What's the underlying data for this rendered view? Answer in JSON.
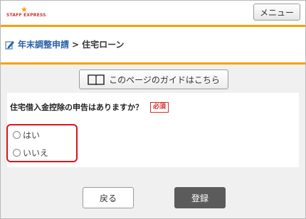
{
  "header": {
    "logo_text": "STAFF EXPRESS",
    "menu_label": "メニュー"
  },
  "breadcrumb": {
    "parent": "年末調整申請",
    "separator": ">",
    "current": "住宅ローン"
  },
  "guide": {
    "label": "このページのガイドはこちら"
  },
  "question": {
    "text": "住宅借入金控除の申告はありますか？",
    "required_label": "必須",
    "options": [
      {
        "label": "はい",
        "selected": false
      },
      {
        "label": "いいえ",
        "selected": false
      }
    ]
  },
  "actions": {
    "back_label": "戻る",
    "register_label": "登録"
  },
  "colors": {
    "accent": "#f5a100",
    "link": "#2a62a8",
    "required": "#d32f2f",
    "highlight": "#e0101c",
    "primary_button": "#5b5b5b"
  }
}
